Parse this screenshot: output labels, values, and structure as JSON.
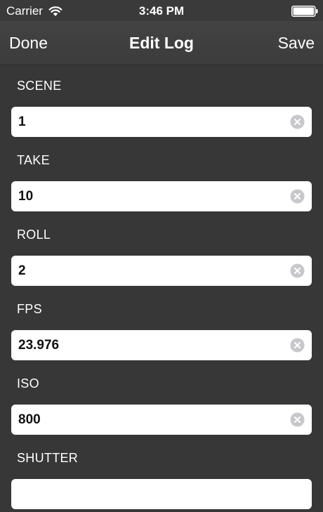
{
  "status_bar": {
    "carrier": "Carrier",
    "time": "3:46 PM",
    "icons": [
      "wifi-icon",
      "battery-icon"
    ]
  },
  "nav": {
    "left_label": "Done",
    "title": "Edit Log",
    "right_label": "Save"
  },
  "fields": [
    {
      "label": "SCENE",
      "value": "1"
    },
    {
      "label": "TAKE",
      "value": "10"
    },
    {
      "label": "ROLL",
      "value": "2"
    },
    {
      "label": "FPS",
      "value": "23.976"
    },
    {
      "label": "ISO",
      "value": "800"
    },
    {
      "label": "SHUTTER",
      "value": ""
    }
  ],
  "colors": {
    "background": "#373737",
    "nav_bar": "#404040",
    "input_background": "#ffffff",
    "text_light": "#ffffff",
    "text_dark": "#111111",
    "clear_icon": "#c7c7cc"
  }
}
